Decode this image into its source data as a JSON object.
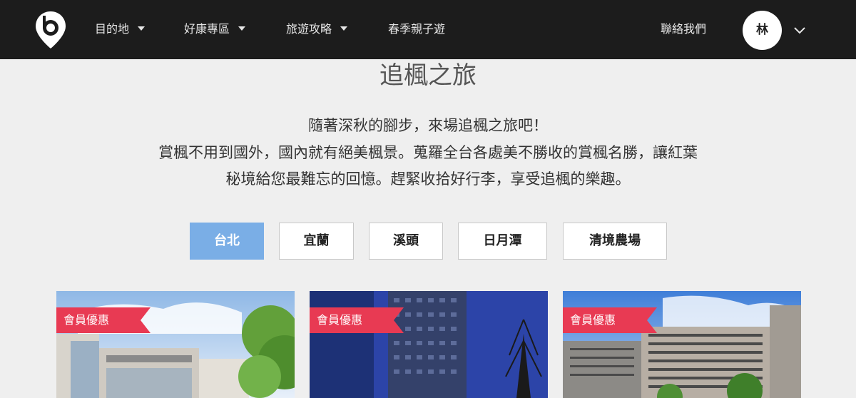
{
  "nav": {
    "items": [
      {
        "label": "目的地",
        "has_dropdown": true
      },
      {
        "label": "好康專區",
        "has_dropdown": true
      },
      {
        "label": "旅遊攻略",
        "has_dropdown": true
      },
      {
        "label": "春季親子遊",
        "has_dropdown": false
      }
    ],
    "contact_label": "聯絡我們",
    "avatar_initial": "林"
  },
  "page": {
    "title": "追楓之旅",
    "intro_lines": [
      "隨著深秋的腳步，來場追楓之旅吧！",
      "賞楓不用到國外，國內就有絕美楓景。蒐羅全台各處美不勝收的賞楓名勝，讓紅葉",
      "秘境給您最難忘的回憶。趕緊收拾好行李，享受追楓的樂趣。"
    ]
  },
  "filters": [
    {
      "label": "台北",
      "active": true
    },
    {
      "label": "宜蘭",
      "active": false
    },
    {
      "label": "溪頭",
      "active": false
    },
    {
      "label": "日月潭",
      "active": false
    },
    {
      "label": "清境農場",
      "active": false
    }
  ],
  "cards": [
    {
      "badge": "會員優惠"
    },
    {
      "badge": "會員優惠"
    },
    {
      "badge": "會員優惠"
    }
  ],
  "colors": {
    "navbar_bg": "#1c1c1c",
    "page_bg": "#efefef",
    "active_filter": "#7aaee6",
    "ribbon": "#e83a53"
  }
}
